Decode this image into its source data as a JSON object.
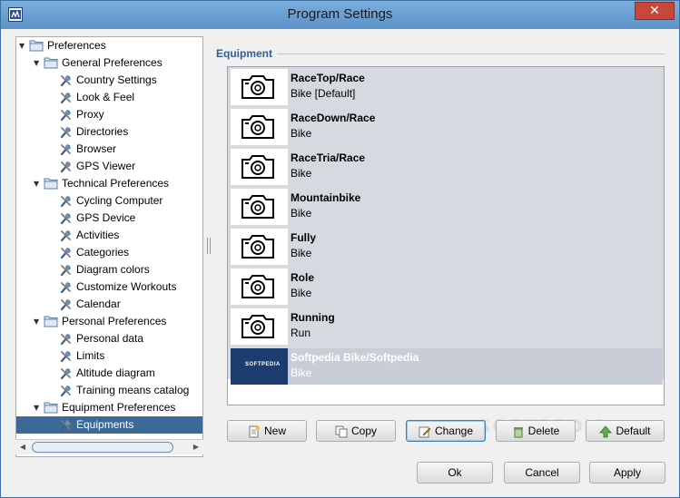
{
  "window": {
    "title": "Program Settings",
    "close_glyph": "✕"
  },
  "tree": {
    "items": [
      {
        "label": "Preferences",
        "level": 0,
        "kind": "folder",
        "expanded": true
      },
      {
        "label": "General Preferences",
        "level": 1,
        "kind": "folder",
        "expanded": true
      },
      {
        "label": "Country Settings",
        "level": 2,
        "kind": "tool"
      },
      {
        "label": "Look & Feel",
        "level": 2,
        "kind": "tool"
      },
      {
        "label": "Proxy",
        "level": 2,
        "kind": "tool"
      },
      {
        "label": "Directories",
        "level": 2,
        "kind": "tool"
      },
      {
        "label": "Browser",
        "level": 2,
        "kind": "tool"
      },
      {
        "label": "GPS Viewer",
        "level": 2,
        "kind": "tool"
      },
      {
        "label": "Technical Preferences",
        "level": 1,
        "kind": "folder",
        "expanded": true
      },
      {
        "label": "Cycling Computer",
        "level": 2,
        "kind": "tool"
      },
      {
        "label": "GPS Device",
        "level": 2,
        "kind": "tool"
      },
      {
        "label": "Activities",
        "level": 2,
        "kind": "tool"
      },
      {
        "label": "Categories",
        "level": 2,
        "kind": "tool"
      },
      {
        "label": "Diagram colors",
        "level": 2,
        "kind": "tool"
      },
      {
        "label": "Customize Workouts",
        "level": 2,
        "kind": "tool"
      },
      {
        "label": "Calendar",
        "level": 2,
        "kind": "tool"
      },
      {
        "label": "Personal Preferences",
        "level": 1,
        "kind": "folder",
        "expanded": true
      },
      {
        "label": "Personal data",
        "level": 2,
        "kind": "tool"
      },
      {
        "label": "Limits",
        "level": 2,
        "kind": "tool"
      },
      {
        "label": "Altitude diagram",
        "level": 2,
        "kind": "tool"
      },
      {
        "label": "Training means catalog",
        "level": 2,
        "kind": "tool"
      },
      {
        "label": "Equipment Preferences",
        "level": 1,
        "kind": "folder",
        "expanded": true
      },
      {
        "label": "Equipments",
        "level": 2,
        "kind": "tool",
        "selected": true
      }
    ]
  },
  "equipment": {
    "group_title": "Equipment",
    "items": [
      {
        "name": "RaceTop/Race",
        "type": "Bike [Default]"
      },
      {
        "name": "RaceDown/Race",
        "type": "Bike"
      },
      {
        "name": "RaceTria/Race",
        "type": "Bike"
      },
      {
        "name": "Mountainbike",
        "type": "Bike"
      },
      {
        "name": "Fully",
        "type": "Bike"
      },
      {
        "name": "Role",
        "type": "Bike"
      },
      {
        "name": "Running",
        "type": "Run"
      },
      {
        "name": "Softpedia Bike/Softpedia",
        "type": "Bike",
        "selected": true,
        "logo_text": "SOFTPEDIA"
      }
    ],
    "buttons": {
      "new": "New",
      "copy": "Copy",
      "change": "Change",
      "delete": "Delete",
      "default": "Default"
    }
  },
  "dialog_buttons": {
    "ok": "Ok",
    "cancel": "Cancel",
    "apply": "Apply"
  },
  "watermark": "SOFTPEDIA",
  "colors": {
    "selection": "#3c6a97",
    "group_title": "#2d5f92",
    "titlebar": "#6a9fd3"
  }
}
